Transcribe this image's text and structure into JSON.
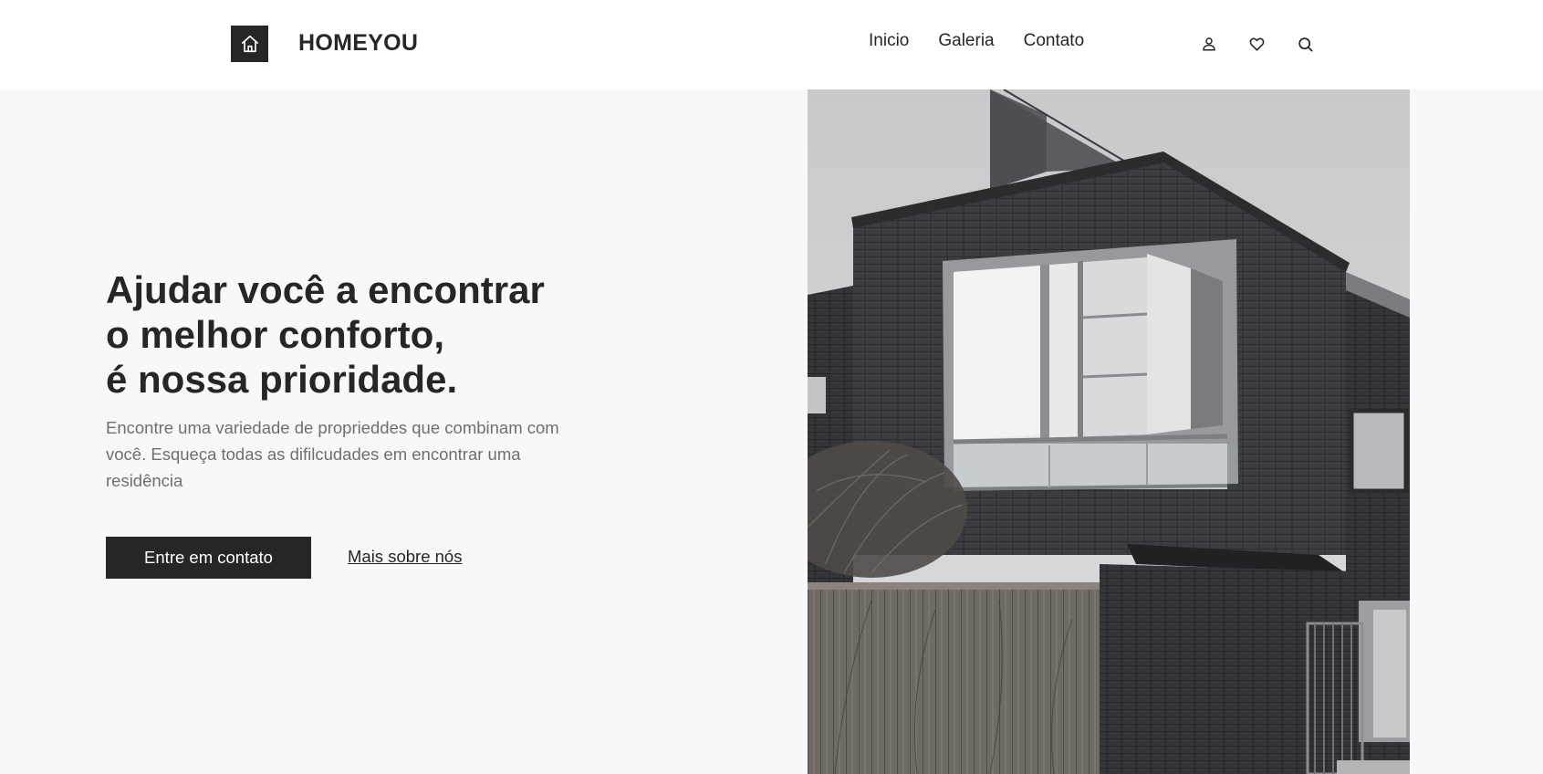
{
  "header": {
    "brand": "HOMEYOU",
    "logo_icon": "home-icon",
    "nav": [
      {
        "label": "Inicio"
      },
      {
        "label": "Galeria"
      },
      {
        "label": "Contato"
      }
    ],
    "icons": [
      "user-icon",
      "heart-icon",
      "search-icon"
    ]
  },
  "hero": {
    "title_lines": [
      "Ajudar você a encontrar",
      "o melhor conforto,",
      "é nossa prioridade."
    ],
    "description": "Encontre uma variedade de proprieddes que combinam com você. Esqueça todas as difilcudades em encontrar uma residência",
    "primary_button": "Entre em contato",
    "secondary_link": "Mais sobre nós",
    "image_subject": "modern dark brick house with large window"
  },
  "colors": {
    "primary": "#262626",
    "background": "#f8f8f8",
    "header_bg": "#ffffff",
    "muted_text": "#6f6f6f"
  }
}
